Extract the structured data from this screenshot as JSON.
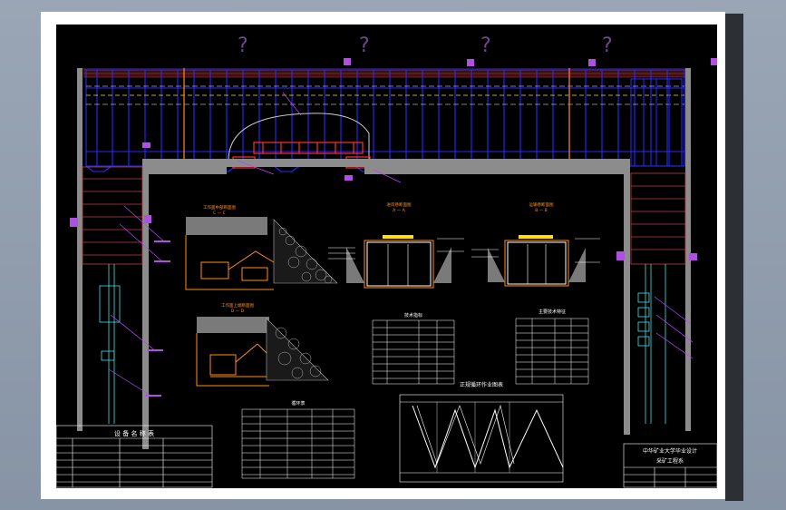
{
  "drawing": {
    "background": "#000000",
    "line_colors": {
      "conveyor": "#2a2aff",
      "rock": "#b04040",
      "support": "#ff3030",
      "wall": "#8c8c8c",
      "annotation": "#c040ff",
      "detail": "#ff8c1a",
      "guide": "#ffe000",
      "cyan": "#40e0e0"
    },
    "markers": [
      "?",
      "?",
      "?",
      "?",
      "?"
    ],
    "section_views": [
      {
        "title": "工作面中部断面图",
        "sub": "C — C"
      },
      {
        "title": "工作面上端断面图",
        "sub": "D — D"
      },
      {
        "title": "进风巷断面图",
        "sub": "A — A"
      },
      {
        "title": "运输巷断面图",
        "sub": "B — B"
      }
    ],
    "tables": {
      "equipment_title": "设 备 名 称 表",
      "small_table_1_title": "技术指标",
      "small_table_2_title": "主要技术特征",
      "table_3_title": "循环表",
      "chart_title": "正规循环作业图表"
    },
    "title_block": {
      "line1": "中华矿业大学毕业设计",
      "line2": "采矿工程系"
    }
  }
}
